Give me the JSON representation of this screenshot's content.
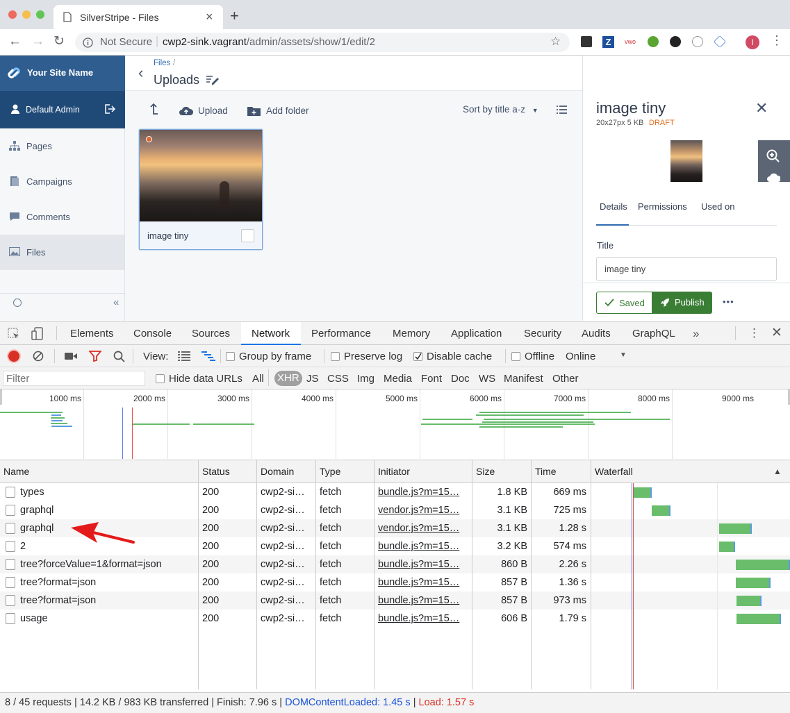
{
  "browser": {
    "tab_title": "SilverStripe - Files",
    "new_tab": "+",
    "security": "Not Secure",
    "url_host": "cwp2-sink.vagrant",
    "url_path": "/admin/assets/show/1/edit/2",
    "profile_initial": "I"
  },
  "cms": {
    "site_name": "Your Site Name",
    "user_name": "Default Admin",
    "nav": [
      {
        "label": "Pages",
        "icon": "sitemap-icon"
      },
      {
        "label": "Campaigns",
        "icon": "campaigns-icon"
      },
      {
        "label": "Comments",
        "icon": "comment-icon"
      },
      {
        "label": "Files",
        "icon": "image-icon",
        "active": true
      }
    ],
    "collapse_glyph": "«",
    "breadcrumb": "Files",
    "breadcrumb_sep": "/",
    "page_title": "Uploads",
    "actions": {
      "upload": "Upload",
      "add_folder": "Add folder"
    },
    "sort_label": "Sort by title a-z",
    "file_tile": {
      "name": "image tiny"
    },
    "panel": {
      "title": "image tiny",
      "meta": "20x27px 5 KB",
      "status": "DRAFT",
      "tabs": [
        "Details",
        "Permissions",
        "Used on"
      ],
      "field_label": "Title",
      "field_value": "image tiny",
      "saved": "Saved",
      "publish": "Publish",
      "more": "•••"
    }
  },
  "devtools": {
    "tabs": [
      "Elements",
      "Console",
      "Sources",
      "Network",
      "Performance",
      "Memory",
      "Application",
      "Security",
      "Audits",
      "GraphQL"
    ],
    "active_tab": "Network",
    "more_tabs": "»",
    "toolbar": {
      "view": "View:",
      "group_by_frame": "Group by frame",
      "preserve_log": "Preserve log",
      "disable_cache": "Disable cache",
      "offline": "Offline",
      "throttle": "Online"
    },
    "filter": {
      "placeholder": "Filter",
      "hide_data_urls": "Hide data URLs",
      "types": [
        "All",
        "XHR",
        "JS",
        "CSS",
        "Img",
        "Media",
        "Font",
        "Doc",
        "WS",
        "Manifest",
        "Other"
      ],
      "active_type": "XHR"
    },
    "timeline_ticks": [
      "1000 ms",
      "2000 ms",
      "3000 ms",
      "4000 ms",
      "5000 ms",
      "6000 ms",
      "7000 ms",
      "8000 ms",
      "9000 ms"
    ],
    "columns": [
      "Name",
      "Status",
      "Domain",
      "Type",
      "Initiator",
      "Size",
      "Time",
      "Waterfall"
    ],
    "sort_glyph": "▲",
    "requests": [
      {
        "name": "types",
        "status": "200",
        "domain": "cwp2-si…",
        "type": "fetch",
        "initiator": "bundle.js?m=15…",
        "size": "1.8 KB",
        "time": "669 ms"
      },
      {
        "name": "graphql",
        "status": "200",
        "domain": "cwp2-si…",
        "type": "fetch",
        "initiator": "vendor.js?m=15…",
        "size": "3.1 KB",
        "time": "725 ms"
      },
      {
        "name": "graphql",
        "status": "200",
        "domain": "cwp2-si…",
        "type": "fetch",
        "initiator": "vendor.js?m=15…",
        "size": "3.1 KB",
        "time": "1.28 s"
      },
      {
        "name": "2",
        "status": "200",
        "domain": "cwp2-si…",
        "type": "fetch",
        "initiator": "bundle.js?m=15…",
        "size": "3.2 KB",
        "time": "574 ms"
      },
      {
        "name": "tree?forceValue=1&format=json",
        "status": "200",
        "domain": "cwp2-si…",
        "type": "fetch",
        "initiator": "bundle.js?m=15…",
        "size": "860 B",
        "time": "2.26 s"
      },
      {
        "name": "tree?format=json",
        "status": "200",
        "domain": "cwp2-si…",
        "type": "fetch",
        "initiator": "bundle.js?m=15…",
        "size": "857 B",
        "time": "1.36 s"
      },
      {
        "name": "tree?format=json",
        "status": "200",
        "domain": "cwp2-si…",
        "type": "fetch",
        "initiator": "bundle.js?m=15…",
        "size": "857 B",
        "time": "973 ms"
      },
      {
        "name": "usage",
        "status": "200",
        "domain": "cwp2-si…",
        "type": "fetch",
        "initiator": "bundle.js?m=15…",
        "size": "606 B",
        "time": "1.79 s"
      }
    ],
    "status": {
      "requests": "8 / 45 requests",
      "sep": "|",
      "transferred": "14.2 KB / 983 KB transferred",
      "finish": "Finish: 7.96 s",
      "dcl": "DOMContentLoaded: 1.45 s",
      "load": "Load: 1.57 s"
    }
  },
  "colors": {
    "cms_blue": "#2f5d8f",
    "publish_green": "#3a7d35",
    "draft_orange": "#e0701e",
    "dcl_blue": "#1a53d8",
    "load_red": "#d93025",
    "waterfall_green": "#6abd6b"
  }
}
